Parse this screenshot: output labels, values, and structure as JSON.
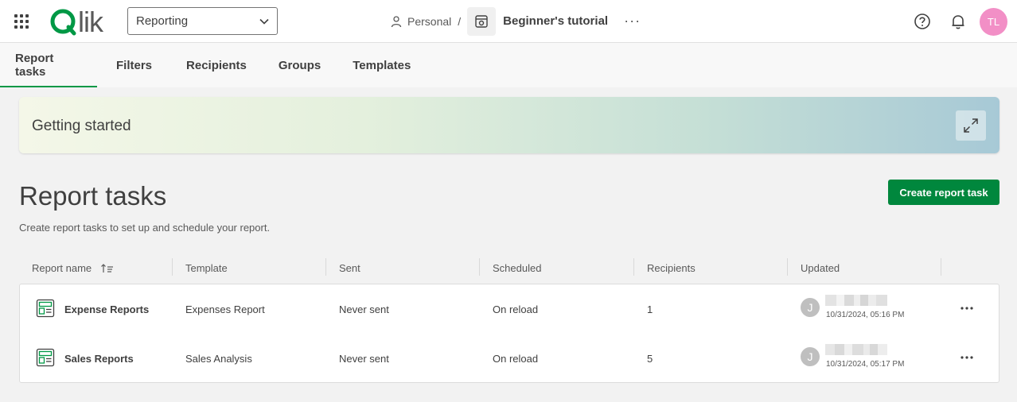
{
  "header": {
    "space_select": "Reporting",
    "breadcrumb_space": "Personal",
    "breadcrumb_sep": "/",
    "app_title": "Beginner's tutorial",
    "more": "···",
    "user_initials": "TL"
  },
  "tabs": [
    {
      "label": "Report tasks"
    },
    {
      "label": "Filters"
    },
    {
      "label": "Recipients"
    },
    {
      "label": "Groups"
    },
    {
      "label": "Templates"
    }
  ],
  "banner": {
    "title": "Getting started"
  },
  "page": {
    "title": "Report tasks",
    "description": "Create report tasks to set up and schedule your report.",
    "create_button": "Create report task"
  },
  "table": {
    "columns": [
      "Report name",
      "Template",
      "Sent",
      "Scheduled",
      "Recipients",
      "Updated"
    ],
    "rows": [
      {
        "name": "Expense Reports",
        "template": "Expenses Report",
        "sent": "Never sent",
        "scheduled": "On reload",
        "recipients": "1",
        "owner_initial": "J",
        "updated": "10/31/2024, 05:16 PM"
      },
      {
        "name": "Sales Reports",
        "template": "Sales Analysis",
        "sent": "Never sent",
        "scheduled": "On reload",
        "recipients": "5",
        "owner_initial": "J",
        "updated": "10/31/2024, 05:17 PM"
      }
    ]
  },
  "colors": {
    "brand_green": "#009845",
    "button_green": "#00873d",
    "avatar_pink": "#f28fc6"
  },
  "icons": [
    "app-grid-icon",
    "chevron-down-icon",
    "person-icon",
    "app-icon",
    "help-icon",
    "bell-icon",
    "expand-icon",
    "sort-icon",
    "report-icon",
    "more-horizontal-icon"
  ]
}
